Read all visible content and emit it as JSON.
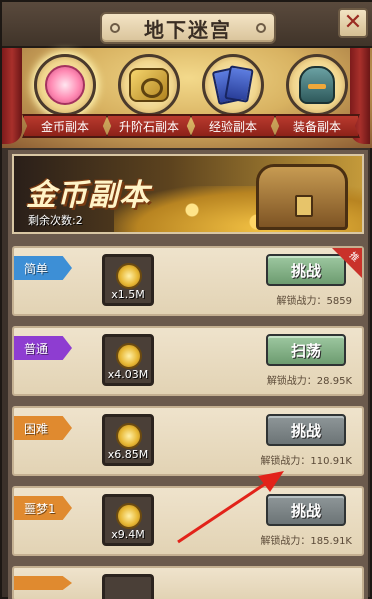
{
  "header": {
    "title": "地下迷宫",
    "close_label": "✕"
  },
  "tabs": [
    {
      "label": "金币副本",
      "icon": "pink-gear-coin-icon",
      "active": true
    },
    {
      "label": "升阶石副本",
      "icon": "gold-stone-icon",
      "active": false
    },
    {
      "label": "经验副本",
      "icon": "blue-cards-icon",
      "active": false
    },
    {
      "label": "装备副本",
      "icon": "helmet-icon",
      "active": false
    }
  ],
  "banner": {
    "title": "金币副本",
    "remaining": "剩余次数:2"
  },
  "rows": [
    {
      "difficulty": "简单",
      "tag_color": "#3d8fd6",
      "reward_qty": "x1.5M",
      "action": "挑战",
      "action_style": "green",
      "power": "解锁战力：5859",
      "badge": "推"
    },
    {
      "difficulty": "普通",
      "tag_color": "#8e3dd1",
      "reward_qty": "x4.03M",
      "action": "扫荡",
      "action_style": "green",
      "power": "解锁战力：28.95K",
      "badge": ""
    },
    {
      "difficulty": "困难",
      "tag_color": "#e08a2f",
      "reward_qty": "x6.85M",
      "action": "挑战",
      "action_style": "grey",
      "power": "解锁战力：110.91K",
      "badge": ""
    },
    {
      "difficulty": "噩梦1",
      "tag_color": "#e08a2f",
      "reward_qty": "x9.4M",
      "action": "挑战",
      "action_style": "grey",
      "power": "解锁战力：185.91K",
      "badge": ""
    }
  ],
  "colors": {
    "arrow": "#e2231a"
  }
}
